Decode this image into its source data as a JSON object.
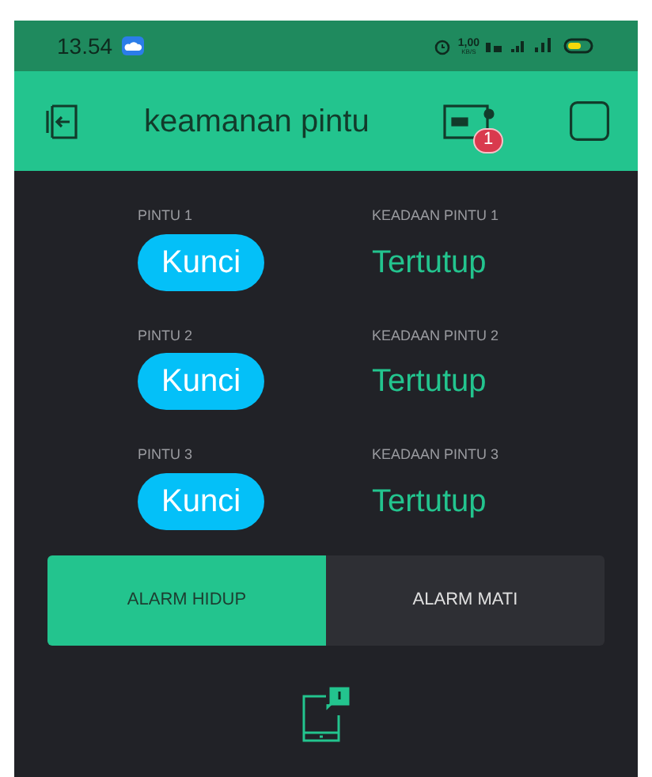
{
  "status_bar": {
    "time": "13.54",
    "speed": "1,00",
    "speed_unit": "KB/S"
  },
  "app_bar": {
    "title": "keamanan pintu",
    "badge": "1"
  },
  "doors": [
    {
      "label": "PINTU 1",
      "button": "Kunci",
      "state_label": "KEADAAN PINTU 1",
      "state": "Tertutup"
    },
    {
      "label": "PINTU 2",
      "button": "Kunci",
      "state_label": "KEADAAN PINTU 2",
      "state": "Tertutup"
    },
    {
      "label": "PINTU 3",
      "button": "Kunci",
      "state_label": "KEADAAN PINTU 3",
      "state": "Tertutup"
    }
  ],
  "alarm": [
    {
      "label": "ALARM HIDUP",
      "selected": true
    },
    {
      "label": "ALARM MATI",
      "selected": false
    }
  ]
}
